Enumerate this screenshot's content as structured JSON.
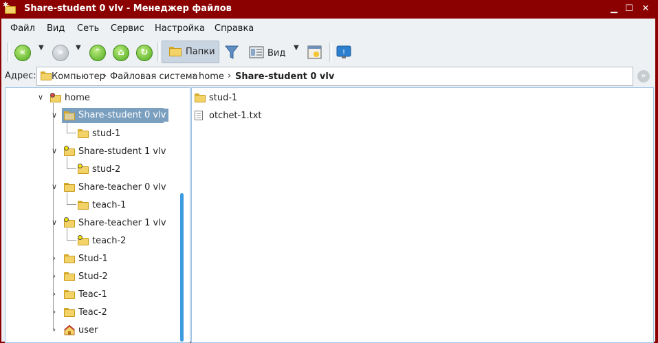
{
  "window": {
    "title": "Share-student 0 vlv - Менеджер файлов",
    "title_color": "#8b0000"
  },
  "menu": {
    "file": "Файл",
    "view": "Вид",
    "network": "Сеть",
    "service": "Сервис",
    "settings": "Настройка",
    "help": "Справка"
  },
  "toolbar": {
    "folders_label": "Папки",
    "view_label": "Вид"
  },
  "address": {
    "label": "Адрес:",
    "crumbs": [
      "Компьютер",
      "Файловая система",
      "home",
      "Share-student 0 vlv"
    ]
  },
  "tree": {
    "home": "home",
    "share_student_0": "Share-student 0 vlv",
    "stud_1": "stud-1",
    "share_student_1": "Share-student 1 vlv",
    "stud_2": "stud-2",
    "share_teacher_0": "Share-teacher 0 vlv",
    "teach_1": "teach-1",
    "share_teacher_1": "Share-teacher 1 vlv",
    "teach_2": "teach-2",
    "stud1": "Stud-1",
    "stud2": "Stud-2",
    "teac1": "Teac-1",
    "teac2": "Teac-2",
    "user": "user"
  },
  "files": {
    "items": [
      "stud-1",
      "otchet-1.txt"
    ]
  },
  "colors": {
    "selection": "#7b9fbf",
    "scrollbar": "#3d9be0",
    "folder": "#f3d268"
  }
}
